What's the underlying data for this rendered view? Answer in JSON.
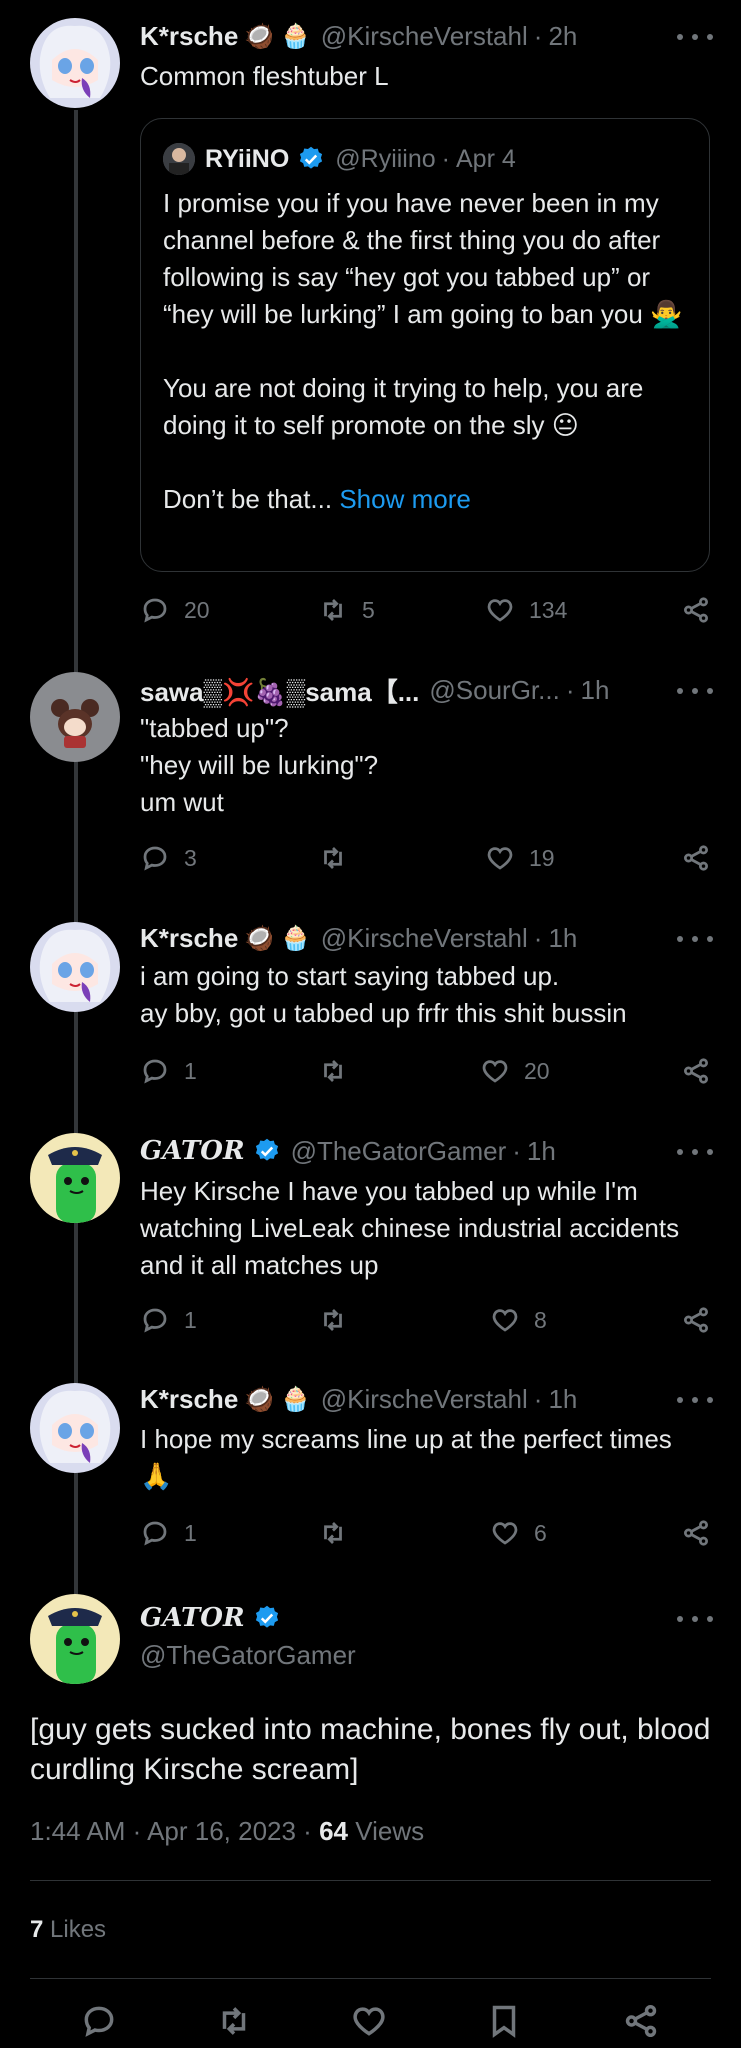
{
  "tweets": [
    {
      "name": "K*rsche",
      "emojis": "🥥 🧁",
      "handle": "@KirscheVerstahl",
      "time": "2h",
      "text": "Common fleshtuber L",
      "quote": {
        "name": "RYiiNO",
        "handle": "@Ryiiino",
        "time": "Apr 4",
        "text": "I promise you if you have never been in my channel before & the first thing you do after following is say “hey got you tabbed up” or “hey will be lurking” I am going to ban you 🙅‍♂️\n\nYou are not doing it trying to help, you are doing it to self promote on the sly 😐\n\nDon’t be that... ",
        "show_more": "Show more"
      },
      "replies": "20",
      "retweets": "5",
      "likes": "134"
    },
    {
      "name": "sawa▒💢🍇▒sama【...",
      "handle": "@SourGr...",
      "time": "1h",
      "text": "\"tabbed up\"?\n\"hey will be lurking\"?\num wut",
      "replies": "3",
      "retweets": "",
      "likes": "19"
    },
    {
      "name": "K*rsche",
      "emojis": "🥥 🧁",
      "handle": "@KirscheVerstahl",
      "time": "1h",
      "text": "i am going to start saying tabbed up.\nay bby, got u tabbed up frfr this shit bussin",
      "replies": "1",
      "retweets": "",
      "likes": "20"
    },
    {
      "name": "GATOR",
      "handle": "@TheGatorGamer",
      "time": "1h",
      "text": "Hey Kirsche I have you tabbed up while I'm watching LiveLeak chinese industrial accidents and it all matches up",
      "replies": "1",
      "retweets": "",
      "likes": "8"
    },
    {
      "name": "K*rsche",
      "emojis": "🥥 🧁",
      "handle": "@KirscheVerstahl",
      "time": "1h",
      "text": "I hope my screams line up at the perfect times 🙏",
      "replies": "1",
      "retweets": "",
      "likes": "6"
    }
  ],
  "main": {
    "name": "GATOR",
    "handle": "@TheGatorGamer",
    "text": "[guy gets sucked into machine, bones fly out, blood curdling Kirsche scream]",
    "time": "1:44 AM · Apr 16, 2023 · ",
    "views_count": "64",
    "views_label": " Views",
    "likes_count": "7",
    "likes_label": " Likes"
  },
  "colors": {
    "accent": "#1d9bf0",
    "muted": "#71767b",
    "divider": "#2f3336",
    "background": "#000000"
  }
}
